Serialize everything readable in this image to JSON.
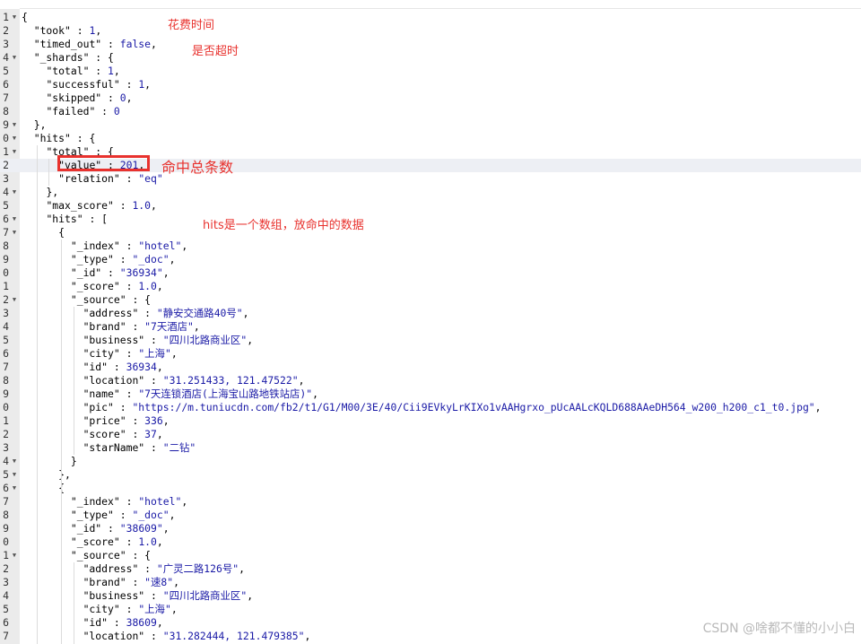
{
  "annotations": {
    "took_note": "花费时间",
    "timed_out_note": "是否超时",
    "total_note": "命中总条数",
    "hits_note": "hits是一个数组，放命中的数据"
  },
  "watermark": "CSDN @啥都不懂的小小白",
  "lines": [
    {
      "n": "1",
      "fold": true,
      "indent": "",
      "tokens": [
        {
          "t": "p",
          "v": "{"
        }
      ]
    },
    {
      "n": "2",
      "indent": "  ",
      "tokens": [
        {
          "t": "k",
          "v": "\"took\""
        },
        {
          "t": "p",
          "v": " : "
        },
        {
          "t": "n",
          "v": "1"
        },
        {
          "t": "p",
          "v": ","
        }
      ]
    },
    {
      "n": "3",
      "indent": "  ",
      "tokens": [
        {
          "t": "k",
          "v": "\"timed_out\""
        },
        {
          "t": "p",
          "v": " : "
        },
        {
          "t": "b",
          "v": "false"
        },
        {
          "t": "p",
          "v": ","
        }
      ]
    },
    {
      "n": "4",
      "fold": true,
      "indent": "  ",
      "tokens": [
        {
          "t": "k",
          "v": "\"_shards\""
        },
        {
          "t": "p",
          "v": " : {"
        }
      ]
    },
    {
      "n": "5",
      "indent": "    ",
      "tokens": [
        {
          "t": "k",
          "v": "\"total\""
        },
        {
          "t": "p",
          "v": " : "
        },
        {
          "t": "n",
          "v": "1"
        },
        {
          "t": "p",
          "v": ","
        }
      ]
    },
    {
      "n": "6",
      "indent": "    ",
      "tokens": [
        {
          "t": "k",
          "v": "\"successful\""
        },
        {
          "t": "p",
          "v": " : "
        },
        {
          "t": "n",
          "v": "1"
        },
        {
          "t": "p",
          "v": ","
        }
      ]
    },
    {
      "n": "7",
      "indent": "    ",
      "tokens": [
        {
          "t": "k",
          "v": "\"skipped\""
        },
        {
          "t": "p",
          "v": " : "
        },
        {
          "t": "n",
          "v": "0"
        },
        {
          "t": "p",
          "v": ","
        }
      ]
    },
    {
      "n": "8",
      "indent": "    ",
      "tokens": [
        {
          "t": "k",
          "v": "\"failed\""
        },
        {
          "t": "p",
          "v": " : "
        },
        {
          "t": "n",
          "v": "0"
        }
      ]
    },
    {
      "n": "9",
      "fold": true,
      "indent": "  ",
      "tokens": [
        {
          "t": "p",
          "v": "},"
        }
      ]
    },
    {
      "n": "0",
      "fold": true,
      "indent": "  ",
      "tokens": [
        {
          "t": "k",
          "v": "\"hits\""
        },
        {
          "t": "p",
          "v": " : {"
        }
      ]
    },
    {
      "n": "1",
      "fold": true,
      "indent": "    ",
      "tokens": [
        {
          "t": "k",
          "v": "\"total\""
        },
        {
          "t": "p",
          "v": " : {"
        }
      ]
    },
    {
      "n": "2",
      "indent": "      ",
      "active": true,
      "tokens": [
        {
          "t": "k",
          "v": "\"value\""
        },
        {
          "t": "p",
          "v": " : "
        },
        {
          "t": "n",
          "v": "201"
        },
        {
          "t": "p",
          "v": ","
        }
      ]
    },
    {
      "n": "3",
      "indent": "      ",
      "tokens": [
        {
          "t": "k",
          "v": "\"relation\""
        },
        {
          "t": "p",
          "v": " : "
        },
        {
          "t": "s",
          "v": "\"eq\""
        }
      ]
    },
    {
      "n": "4",
      "fold": true,
      "indent": "    ",
      "tokens": [
        {
          "t": "p",
          "v": "},"
        }
      ]
    },
    {
      "n": "5",
      "indent": "    ",
      "tokens": [
        {
          "t": "k",
          "v": "\"max_score\""
        },
        {
          "t": "p",
          "v": " : "
        },
        {
          "t": "n",
          "v": "1.0"
        },
        {
          "t": "p",
          "v": ","
        }
      ]
    },
    {
      "n": "6",
      "fold": true,
      "indent": "    ",
      "tokens": [
        {
          "t": "k",
          "v": "\"hits\""
        },
        {
          "t": "p",
          "v": " : ["
        }
      ]
    },
    {
      "n": "7",
      "fold": true,
      "indent": "      ",
      "tokens": [
        {
          "t": "p",
          "v": "{"
        }
      ]
    },
    {
      "n": "8",
      "indent": "        ",
      "tokens": [
        {
          "t": "k",
          "v": "\"_index\""
        },
        {
          "t": "p",
          "v": " : "
        },
        {
          "t": "s",
          "v": "\"hotel\""
        },
        {
          "t": "p",
          "v": ","
        }
      ]
    },
    {
      "n": "9",
      "indent": "        ",
      "tokens": [
        {
          "t": "k",
          "v": "\"_type\""
        },
        {
          "t": "p",
          "v": " : "
        },
        {
          "t": "s",
          "v": "\"_doc\""
        },
        {
          "t": "p",
          "v": ","
        }
      ]
    },
    {
      "n": "0",
      "indent": "        ",
      "tokens": [
        {
          "t": "k",
          "v": "\"_id\""
        },
        {
          "t": "p",
          "v": " : "
        },
        {
          "t": "s",
          "v": "\"36934\""
        },
        {
          "t": "p",
          "v": ","
        }
      ]
    },
    {
      "n": "1",
      "indent": "        ",
      "tokens": [
        {
          "t": "k",
          "v": "\"_score\""
        },
        {
          "t": "p",
          "v": " : "
        },
        {
          "t": "n",
          "v": "1.0"
        },
        {
          "t": "p",
          "v": ","
        }
      ]
    },
    {
      "n": "2",
      "fold": true,
      "indent": "        ",
      "tokens": [
        {
          "t": "k",
          "v": "\"_source\""
        },
        {
          "t": "p",
          "v": " : {"
        }
      ]
    },
    {
      "n": "3",
      "indent": "          ",
      "tokens": [
        {
          "t": "k",
          "v": "\"address\""
        },
        {
          "t": "p",
          "v": " : "
        },
        {
          "t": "s",
          "v": "\"静安交通路40号\""
        },
        {
          "t": "p",
          "v": ","
        }
      ]
    },
    {
      "n": "4",
      "indent": "          ",
      "tokens": [
        {
          "t": "k",
          "v": "\"brand\""
        },
        {
          "t": "p",
          "v": " : "
        },
        {
          "t": "s",
          "v": "\"7天酒店\""
        },
        {
          "t": "p",
          "v": ","
        }
      ]
    },
    {
      "n": "5",
      "indent": "          ",
      "tokens": [
        {
          "t": "k",
          "v": "\"business\""
        },
        {
          "t": "p",
          "v": " : "
        },
        {
          "t": "s",
          "v": "\"四川北路商业区\""
        },
        {
          "t": "p",
          "v": ","
        }
      ]
    },
    {
      "n": "6",
      "indent": "          ",
      "tokens": [
        {
          "t": "k",
          "v": "\"city\""
        },
        {
          "t": "p",
          "v": " : "
        },
        {
          "t": "s",
          "v": "\"上海\""
        },
        {
          "t": "p",
          "v": ","
        }
      ]
    },
    {
      "n": "7",
      "indent": "          ",
      "tokens": [
        {
          "t": "k",
          "v": "\"id\""
        },
        {
          "t": "p",
          "v": " : "
        },
        {
          "t": "n",
          "v": "36934"
        },
        {
          "t": "p",
          "v": ","
        }
      ]
    },
    {
      "n": "8",
      "indent": "          ",
      "tokens": [
        {
          "t": "k",
          "v": "\"location\""
        },
        {
          "t": "p",
          "v": " : "
        },
        {
          "t": "s",
          "v": "\"31.251433, 121.47522\""
        },
        {
          "t": "p",
          "v": ","
        }
      ]
    },
    {
      "n": "9",
      "indent": "          ",
      "tokens": [
        {
          "t": "k",
          "v": "\"name\""
        },
        {
          "t": "p",
          "v": " : "
        },
        {
          "t": "s",
          "v": "\"7天连锁酒店(上海宝山路地铁站店)\""
        },
        {
          "t": "p",
          "v": ","
        }
      ]
    },
    {
      "n": "0",
      "indent": "          ",
      "tokens": [
        {
          "t": "k",
          "v": "\"pic\""
        },
        {
          "t": "p",
          "v": " : "
        },
        {
          "t": "s",
          "v": "\"https://m.tuniucdn.com/fb2/t1/G1/M00/3E/40/Cii9EVkyLrKIXo1vAAHgrxo_pUcAALcKQLD688AAeDH564_w200_h200_c1_t0.jpg\""
        },
        {
          "t": "p",
          "v": ","
        }
      ]
    },
    {
      "n": "1",
      "indent": "          ",
      "tokens": [
        {
          "t": "k",
          "v": "\"price\""
        },
        {
          "t": "p",
          "v": " : "
        },
        {
          "t": "n",
          "v": "336"
        },
        {
          "t": "p",
          "v": ","
        }
      ]
    },
    {
      "n": "2",
      "indent": "          ",
      "tokens": [
        {
          "t": "k",
          "v": "\"score\""
        },
        {
          "t": "p",
          "v": " : "
        },
        {
          "t": "n",
          "v": "37"
        },
        {
          "t": "p",
          "v": ","
        }
      ]
    },
    {
      "n": "3",
      "indent": "          ",
      "tokens": [
        {
          "t": "k",
          "v": "\"starName\""
        },
        {
          "t": "p",
          "v": " : "
        },
        {
          "t": "s",
          "v": "\"二钻\""
        }
      ]
    },
    {
      "n": "4",
      "fold": true,
      "indent": "        ",
      "tokens": [
        {
          "t": "p",
          "v": "}"
        }
      ]
    },
    {
      "n": "5",
      "fold": true,
      "indent": "      ",
      "tokens": [
        {
          "t": "p",
          "v": "},"
        }
      ]
    },
    {
      "n": "6",
      "fold": true,
      "indent": "      ",
      "tokens": [
        {
          "t": "p",
          "v": "{"
        }
      ]
    },
    {
      "n": "7",
      "indent": "        ",
      "tokens": [
        {
          "t": "k",
          "v": "\"_index\""
        },
        {
          "t": "p",
          "v": " : "
        },
        {
          "t": "s",
          "v": "\"hotel\""
        },
        {
          "t": "p",
          "v": ","
        }
      ]
    },
    {
      "n": "8",
      "indent": "        ",
      "tokens": [
        {
          "t": "k",
          "v": "\"_type\""
        },
        {
          "t": "p",
          "v": " : "
        },
        {
          "t": "s",
          "v": "\"_doc\""
        },
        {
          "t": "p",
          "v": ","
        }
      ]
    },
    {
      "n": "9",
      "indent": "        ",
      "tokens": [
        {
          "t": "k",
          "v": "\"_id\""
        },
        {
          "t": "p",
          "v": " : "
        },
        {
          "t": "s",
          "v": "\"38609\""
        },
        {
          "t": "p",
          "v": ","
        }
      ]
    },
    {
      "n": "0",
      "indent": "        ",
      "tokens": [
        {
          "t": "k",
          "v": "\"_score\""
        },
        {
          "t": "p",
          "v": " : "
        },
        {
          "t": "n",
          "v": "1.0"
        },
        {
          "t": "p",
          "v": ","
        }
      ]
    },
    {
      "n": "1",
      "fold": true,
      "indent": "        ",
      "tokens": [
        {
          "t": "k",
          "v": "\"_source\""
        },
        {
          "t": "p",
          "v": " : {"
        }
      ]
    },
    {
      "n": "2",
      "indent": "          ",
      "tokens": [
        {
          "t": "k",
          "v": "\"address\""
        },
        {
          "t": "p",
          "v": " : "
        },
        {
          "t": "s",
          "v": "\"广灵二路126号\""
        },
        {
          "t": "p",
          "v": ","
        }
      ]
    },
    {
      "n": "3",
      "indent": "          ",
      "tokens": [
        {
          "t": "k",
          "v": "\"brand\""
        },
        {
          "t": "p",
          "v": " : "
        },
        {
          "t": "s",
          "v": "\"速8\""
        },
        {
          "t": "p",
          "v": ","
        }
      ]
    },
    {
      "n": "4",
      "indent": "          ",
      "tokens": [
        {
          "t": "k",
          "v": "\"business\""
        },
        {
          "t": "p",
          "v": " : "
        },
        {
          "t": "s",
          "v": "\"四川北路商业区\""
        },
        {
          "t": "p",
          "v": ","
        }
      ]
    },
    {
      "n": "5",
      "indent": "          ",
      "tokens": [
        {
          "t": "k",
          "v": "\"city\""
        },
        {
          "t": "p",
          "v": " : "
        },
        {
          "t": "s",
          "v": "\"上海\""
        },
        {
          "t": "p",
          "v": ","
        }
      ]
    },
    {
      "n": "6",
      "indent": "          ",
      "tokens": [
        {
          "t": "k",
          "v": "\"id\""
        },
        {
          "t": "p",
          "v": " : "
        },
        {
          "t": "n",
          "v": "38609"
        },
        {
          "t": "p",
          "v": ","
        }
      ]
    },
    {
      "n": "7",
      "indent": "          ",
      "tokens": [
        {
          "t": "k",
          "v": "\"location\""
        },
        {
          "t": "p",
          "v": " : "
        },
        {
          "t": "s",
          "v": "\"31.282444, 121.479385\""
        },
        {
          "t": "p",
          "v": ","
        }
      ]
    }
  ]
}
